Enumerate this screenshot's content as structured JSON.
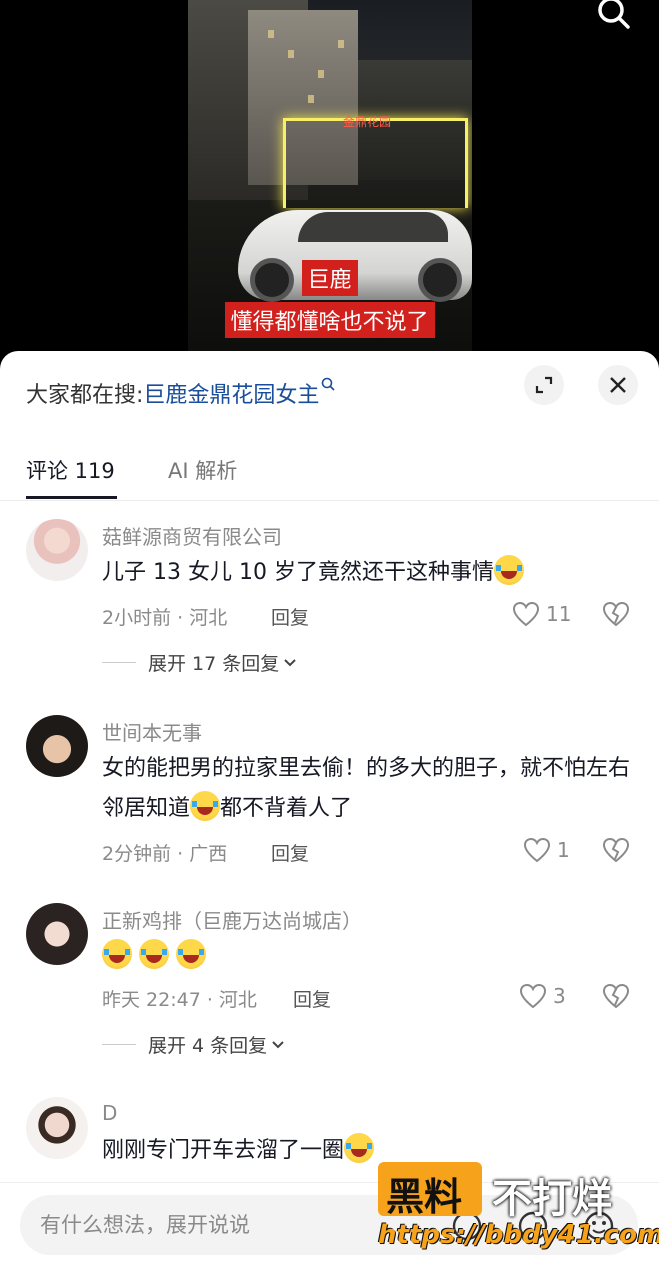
{
  "video": {
    "gate_sign": "金鼎花园",
    "caption_line1": "巨鹿",
    "caption_line2": "懂得都懂啥也不说了"
  },
  "sheet": {
    "suggest_label": "大家都在搜:",
    "suggest_link": "巨鹿金鼎花园女主",
    "tabs": [
      {
        "label": "评论 119",
        "active": true
      },
      {
        "label": "AI 解析",
        "active": false
      }
    ]
  },
  "comments": [
    {
      "user": "菇鲜源商贸有限公司",
      "text": "儿子 13 女儿 10 岁了竟然还干这种事情",
      "time_loc": "2小时前 · 河北",
      "reply": "回复",
      "likes": "11",
      "expand": "展开 17 条回复"
    },
    {
      "user": "世间本无事",
      "text_a": "女的能把男的拉家里去偷！的多大的胆子，就不怕左右邻居知道",
      "text_b": "都不背着人了",
      "time_loc": "2分钟前 · 广西",
      "reply": "回复",
      "likes": "1"
    },
    {
      "user": "正新鸡排（巨鹿万达尚城店）",
      "time_loc": "昨天 22:47 · 河北",
      "reply": "回复",
      "likes": "3",
      "expand": "展开 4 条回复"
    },
    {
      "user": "D",
      "text": "刚刚专门开车去溜了一圈"
    }
  ],
  "input": {
    "placeholder": "有什么想法，展开说说"
  },
  "watermark": {
    "brand_a": "黑料",
    "brand_b": "不打烊",
    "url": "https://bbdy41.com"
  }
}
